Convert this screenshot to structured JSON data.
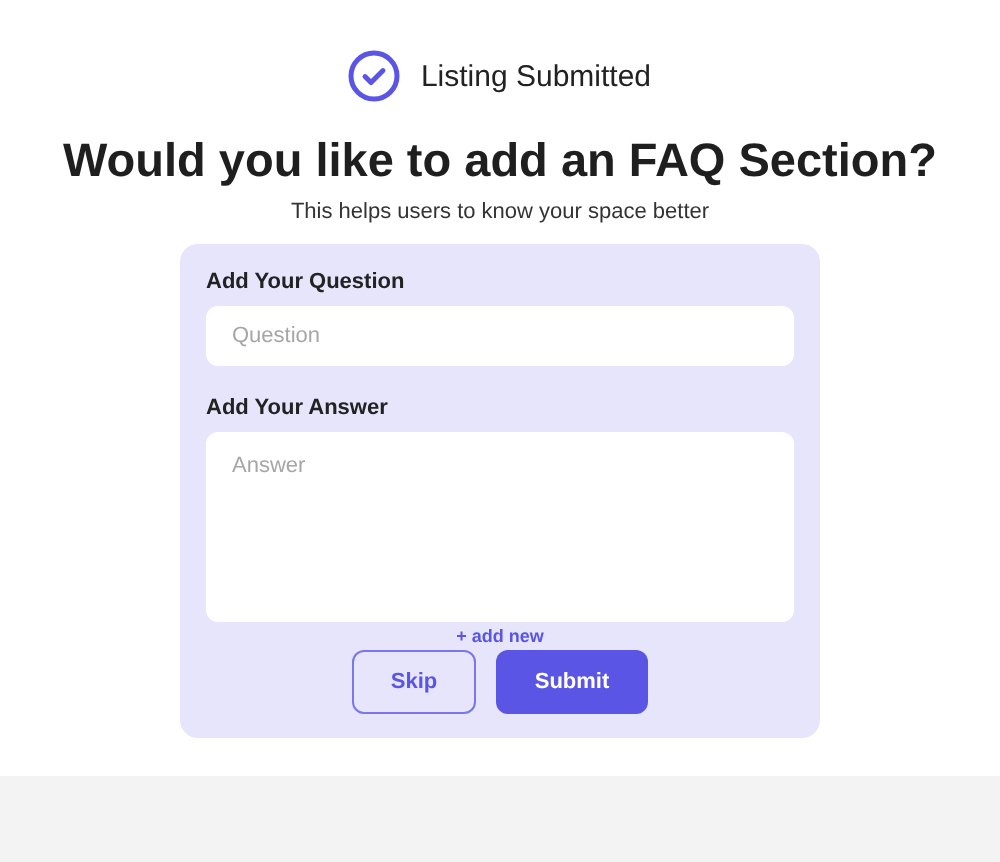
{
  "status": {
    "label": "Listing Submitted"
  },
  "heading": "Would you like to add an FAQ Section?",
  "subtitle": "This helps users to know your space better",
  "form": {
    "fields": [
      {
        "kind": "input",
        "label": "Add Your Question",
        "placeholder": "Question"
      },
      {
        "kind": "textarea",
        "label": "Add Your Answer",
        "placeholder": "Answer"
      }
    ],
    "add_link": "+ add new",
    "buttons": [
      {
        "kind": "secondary",
        "label": "Skip"
      },
      {
        "kind": "primary",
        "label": "Submit"
      }
    ]
  }
}
